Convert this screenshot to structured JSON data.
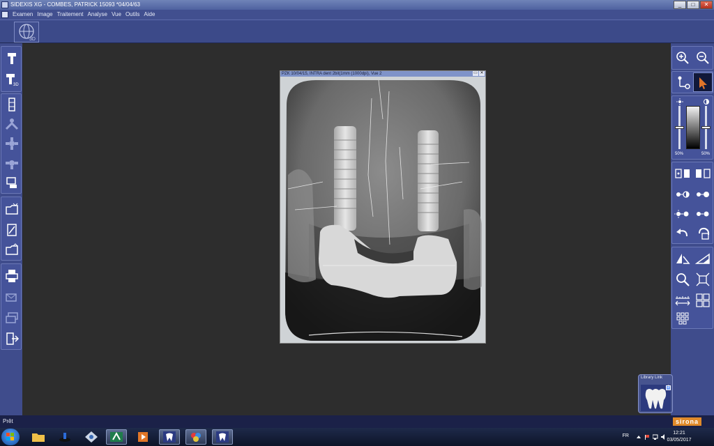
{
  "window": {
    "title": "SIDEXIS XG - COMBES, PATRICK 15093 *04/04/63",
    "controls": [
      "_",
      "□",
      "✕"
    ]
  },
  "menu": {
    "items": [
      "Examen",
      "Image",
      "Traitement",
      "Analyse",
      "Vue",
      "Outils",
      "Aide"
    ]
  },
  "image_window": {
    "title": "PZK 10/04/15, INTRA dent 2bit(1mm (1000dpi), Vue 2",
    "controls": [
      "▭",
      "✕"
    ]
  },
  "right_tools": {
    "brightness_label": "50%",
    "contrast_label": "50%",
    "brightness_level": 0.5,
    "contrast_level": 0.5
  },
  "thumbnail": {
    "label": "Library Link",
    "badge": "2"
  },
  "status": {
    "text": "Prêt",
    "brand": "sirona"
  },
  "taskbar": {
    "language": "FR",
    "time": "12:21",
    "date": "03/05/2017"
  },
  "colors": {
    "panel": "#3f4c8c",
    "workspace": "#2d2d2d",
    "accent": "#e08a2a",
    "cursor_arrow": "#e0742a"
  }
}
